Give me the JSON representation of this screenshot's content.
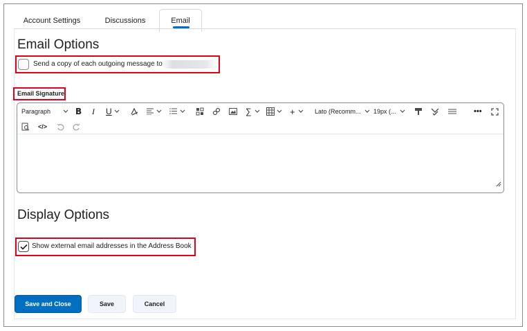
{
  "tabs": [
    {
      "label": "Account Settings"
    },
    {
      "label": "Discussions"
    },
    {
      "label": "Email",
      "active": true
    }
  ],
  "email_options": {
    "heading": "Email Options",
    "send_copy_label": "Send a copy of each outgoing message to",
    "send_copy_checked": false
  },
  "signature": {
    "label": "Email Signature",
    "toolbar": {
      "paragraph": "Paragraph",
      "font": "Lato (Recomm...",
      "size": "19px (..."
    }
  },
  "display_options": {
    "heading": "Display Options",
    "show_external_label": "Show external email addresses in the Address Book",
    "show_external_checked": true
  },
  "buttons": {
    "save_close": "Save and Close",
    "save": "Save",
    "cancel": "Cancel"
  },
  "colors": {
    "primary": "#006fbf",
    "highlight": "#e0001b"
  }
}
